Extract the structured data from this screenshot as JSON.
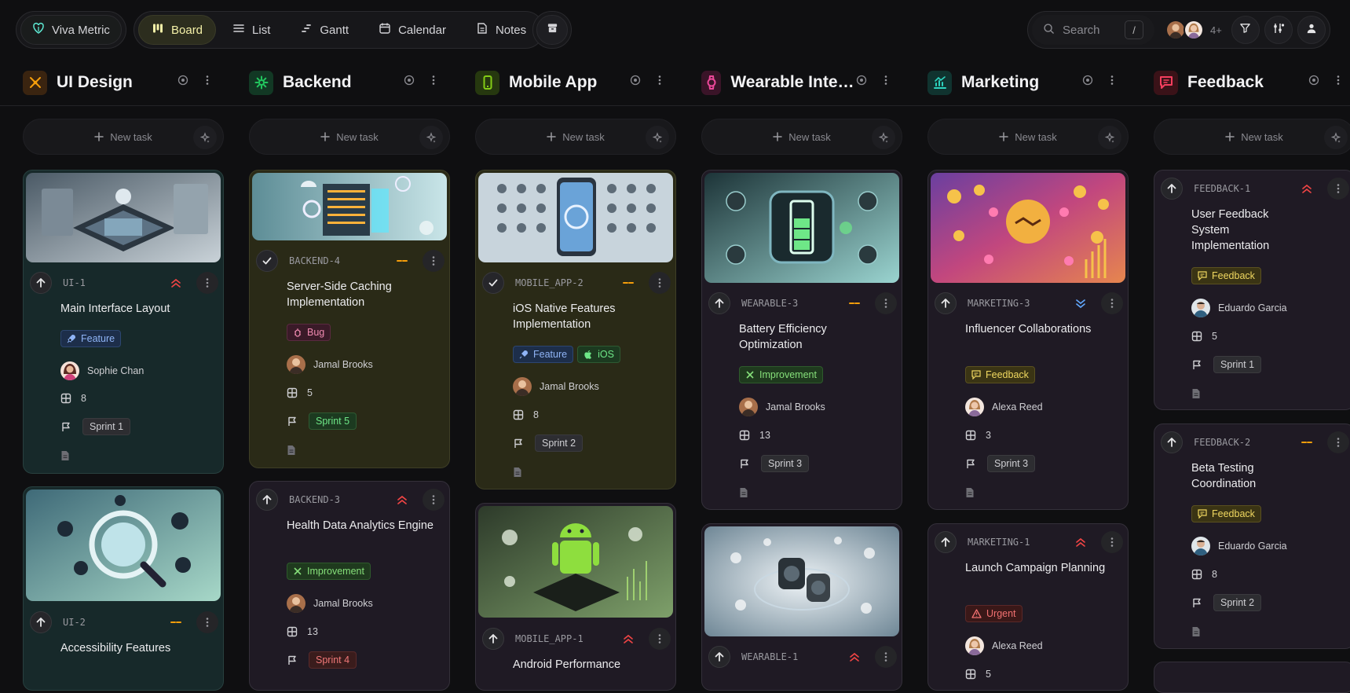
{
  "topbar": {
    "workspace": "Viva Metric",
    "views": [
      {
        "label": "Board",
        "active": true
      },
      {
        "label": "List"
      },
      {
        "label": "Gantt"
      },
      {
        "label": "Calendar"
      },
      {
        "label": "Notes"
      }
    ],
    "search_placeholder": "Search",
    "search_shortcut": "/",
    "extra_members": "4+"
  },
  "new_task_label": "New task",
  "columns": [
    {
      "title": "UI Design",
      "color": "#f59e0b"
    },
    {
      "title": "Backend",
      "color": "#22c55e"
    },
    {
      "title": "Mobile App",
      "color": "#84cc16"
    },
    {
      "title": "Wearable Integration",
      "color": "#ec4899"
    },
    {
      "title": "Marketing",
      "color": "#2dd4bf"
    },
    {
      "title": "Feedback",
      "color": "#f43f5e"
    }
  ],
  "cards": {
    "ui1": {
      "id": "UI-1",
      "title": "Main Interface Layout",
      "tag": "Feature",
      "assignee": "Sophie Chan",
      "points": "8",
      "sprint": "Sprint 1"
    },
    "ui2": {
      "id": "UI-2",
      "title": "Accessibility Features"
    },
    "be4": {
      "id": "BACKEND-4",
      "title": "Server-Side Caching Implementation",
      "tag": "Bug",
      "assignee": "Jamal Brooks",
      "points": "5",
      "sprint": "Sprint 5"
    },
    "be3": {
      "id": "BACKEND-3",
      "title": "Health Data Analytics Engine",
      "tag": "Improvement",
      "assignee": "Jamal Brooks",
      "points": "13",
      "sprint": "Sprint 4"
    },
    "ma2": {
      "id": "MOBILE_APP-2",
      "title": "iOS Native Features Implementation",
      "tags": [
        "Feature",
        "iOS"
      ],
      "assignee": "Jamal Brooks",
      "points": "8",
      "sprint": "Sprint 2"
    },
    "ma1": {
      "id": "MOBILE_APP-1",
      "title": "Android Performance"
    },
    "we3": {
      "id": "WEARABLE-3",
      "title": "Battery Efficiency Optimization",
      "tag": "Improvement",
      "assignee": "Jamal Brooks",
      "points": "13",
      "sprint": "Sprint 3"
    },
    "we1": {
      "id": "WEARABLE-1"
    },
    "mk3": {
      "id": "MARKETING-3",
      "title": "Influencer Collaborations",
      "tag": "Feedback",
      "assignee": "Alexa Reed",
      "points": "3",
      "sprint": "Sprint 3"
    },
    "mk1": {
      "id": "MARKETING-1",
      "title": "Launch Campaign Planning",
      "tag": "Urgent",
      "assignee": "Alexa Reed",
      "points": "5"
    },
    "fb1": {
      "id": "FEEDBACK-1",
      "title": "User Feedback System Implementation",
      "tag": "Feedback",
      "assignee": "Eduardo Garcia",
      "points": "5",
      "sprint": "Sprint 1"
    },
    "fb2": {
      "id": "FEEDBACK-2",
      "title": "Beta Testing Coordination",
      "tag": "Feedback",
      "assignee": "Eduardo Garcia",
      "points": "8",
      "sprint": "Sprint 2"
    }
  }
}
